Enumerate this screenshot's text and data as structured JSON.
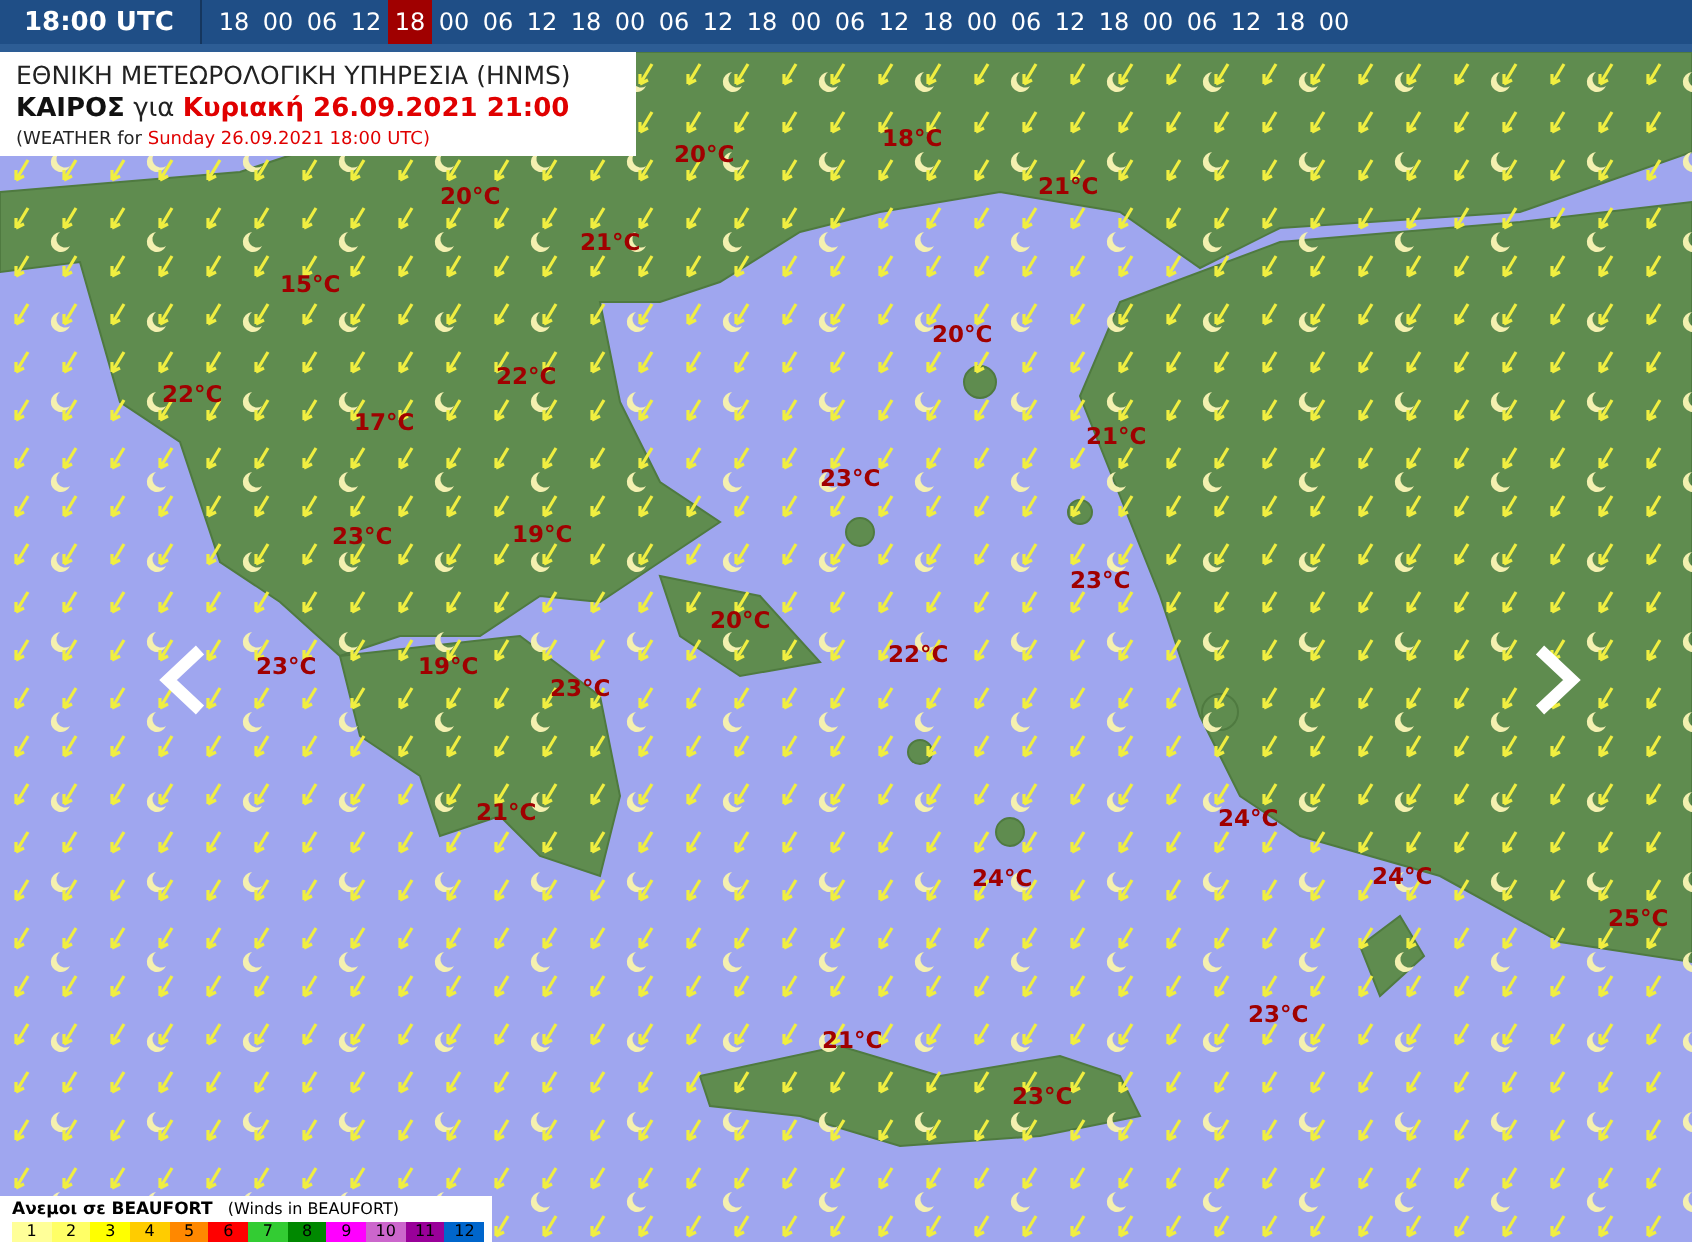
{
  "timeline": {
    "current": "18:00 UTC",
    "steps": [
      {
        "label": "18",
        "selected": false
      },
      {
        "label": "00",
        "selected": false
      },
      {
        "label": "06",
        "selected": false
      },
      {
        "label": "12",
        "selected": false
      },
      {
        "label": "18",
        "selected": true
      },
      {
        "label": "00",
        "selected": false
      },
      {
        "label": "06",
        "selected": false
      },
      {
        "label": "12",
        "selected": false
      },
      {
        "label": "18",
        "selected": false
      },
      {
        "label": "00",
        "selected": false
      },
      {
        "label": "06",
        "selected": false
      },
      {
        "label": "12",
        "selected": false
      },
      {
        "label": "18",
        "selected": false
      },
      {
        "label": "00",
        "selected": false
      },
      {
        "label": "06",
        "selected": false
      },
      {
        "label": "12",
        "selected": false
      },
      {
        "label": "18",
        "selected": false
      },
      {
        "label": "00",
        "selected": false
      },
      {
        "label": "06",
        "selected": false
      },
      {
        "label": "12",
        "selected": false
      },
      {
        "label": "18",
        "selected": false
      },
      {
        "label": "00",
        "selected": false
      },
      {
        "label": "06",
        "selected": false
      },
      {
        "label": "12",
        "selected": false
      },
      {
        "label": "18",
        "selected": false
      },
      {
        "label": "00",
        "selected": false
      }
    ]
  },
  "header": {
    "title": "ΕΘΝΙΚΗ ΜΕΤΕΩΡΟΛΟΓΙΚΗ ΥΠΗΡΕΣΙΑ (HNMS)",
    "label": "ΚΑΙΡΟΣ",
    "connector": "για",
    "date": "Κυριακή 26.09.2021 21:00",
    "subtitle_prefix": "(WEATHER for",
    "subtitle_date": "Sunday 26.09.2021 18:00 UTC)"
  },
  "temperatures": [
    "20°C",
    "18°C",
    "21°C",
    "20°C",
    "21°C",
    "15°C",
    "20°C",
    "22°C",
    "22°C",
    "17°C",
    "21°C",
    "23°C",
    "23°C",
    "19°C",
    "23°C",
    "20°C",
    "22°C",
    "23°C",
    "19°C",
    "23°C",
    "21°C",
    "24°C",
    "24°C",
    "24°C",
    "25°C",
    "23°C",
    "21°C",
    "23°C"
  ],
  "legend": {
    "title": "Ανεμοι σε BEAUFORT",
    "subtitle": "(Winds in BEAUFORT)",
    "scale": [
      {
        "label": "1",
        "color": "#ffff99"
      },
      {
        "label": "2",
        "color": "#ffff66"
      },
      {
        "label": "3",
        "color": "#ffff00"
      },
      {
        "label": "4",
        "color": "#ffcc00"
      },
      {
        "label": "5",
        "color": "#ff8800"
      },
      {
        "label": "6",
        "color": "#ff0000"
      },
      {
        "label": "7",
        "color": "#33cc33"
      },
      {
        "label": "8",
        "color": "#008800"
      },
      {
        "label": "9",
        "color": "#ff00ff"
      },
      {
        "label": "10",
        "color": "#cc66cc"
      },
      {
        "label": "11",
        "color": "#990099"
      },
      {
        "label": "12",
        "color": "#0066cc"
      }
    ]
  }
}
